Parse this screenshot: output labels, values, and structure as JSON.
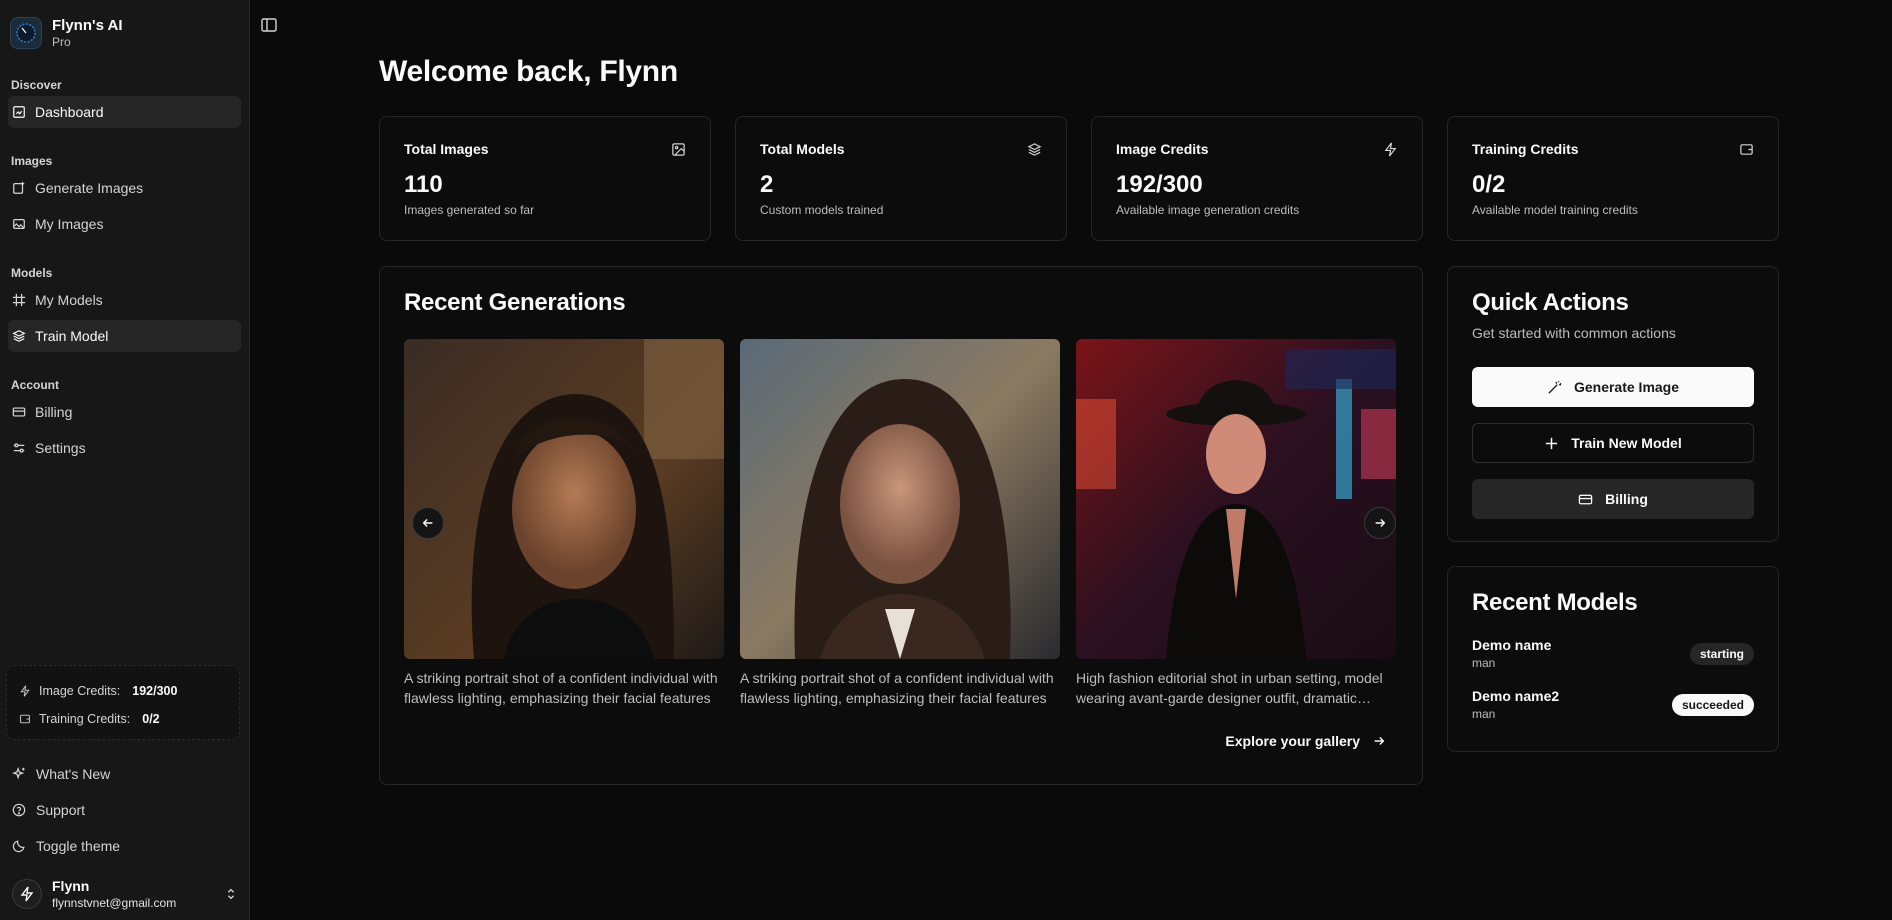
{
  "brand": {
    "name": "Flynn's AI",
    "plan": "Pro"
  },
  "sidebar": {
    "groups": [
      {
        "label": "Discover",
        "items": [
          {
            "label": "Dashboard",
            "icon": "dashboard-icon",
            "active": true
          }
        ]
      },
      {
        "label": "Images",
        "items": [
          {
            "label": "Generate Images",
            "icon": "image-plus-icon"
          },
          {
            "label": "My Images",
            "icon": "images-icon"
          }
        ]
      },
      {
        "label": "Models",
        "items": [
          {
            "label": "My Models",
            "icon": "frame-icon"
          },
          {
            "label": "Train Model",
            "icon": "layers-icon",
            "active": true
          }
        ]
      },
      {
        "label": "Account",
        "items": [
          {
            "label": "Billing",
            "icon": "credit-card-icon"
          },
          {
            "label": "Settings",
            "icon": "sliders-icon"
          }
        ]
      }
    ],
    "credits": {
      "image_label": "Image Credits:",
      "image_value": "192/300",
      "training_label": "Training Credits:",
      "training_value": "0/2"
    },
    "bottom": [
      {
        "label": "What's New",
        "icon": "sparkles-icon"
      },
      {
        "label": "Support",
        "icon": "help-circle-icon"
      },
      {
        "label": "Toggle theme",
        "icon": "moon-icon"
      }
    ],
    "user": {
      "name": "Flynn",
      "email": "flynnstvnet@gmail.com"
    }
  },
  "main": {
    "title": "Welcome back, Flynn",
    "stats": [
      {
        "label": "Total Images",
        "value": "110",
        "desc": "Images generated so far",
        "icon": "image-icon"
      },
      {
        "label": "Total Models",
        "value": "2",
        "desc": "Custom models trained",
        "icon": "layers-icon"
      },
      {
        "label": "Image Credits",
        "value": "192/300",
        "desc": "Available image generation credits",
        "icon": "zap-icon"
      },
      {
        "label": "Training Credits",
        "value": "0/2",
        "desc": "Available model training credits",
        "icon": "wallet-icon"
      }
    ],
    "recent": {
      "title": "Recent Generations",
      "items": [
        {
          "caption": "A striking portrait shot of a confident individual with flawless lighting, emphasizing their facial features"
        },
        {
          "caption": "A striking portrait shot of a confident individual with flawless lighting, emphasizing their facial features"
        },
        {
          "caption": "High fashion editorial shot in urban setting, model wearing avant-garde designer outfit, dramatic lighting"
        }
      ],
      "explore": "Explore your gallery"
    },
    "quick": {
      "title": "Quick Actions",
      "subtitle": "Get started with common actions",
      "generate": "Generate Image",
      "train": "Train New Model",
      "billing": "Billing"
    },
    "models": {
      "title": "Recent Models",
      "items": [
        {
          "name": "Demo name",
          "type": "man",
          "status": "starting"
        },
        {
          "name": "Demo name2",
          "type": "man",
          "status": "succeeded"
        }
      ]
    }
  }
}
